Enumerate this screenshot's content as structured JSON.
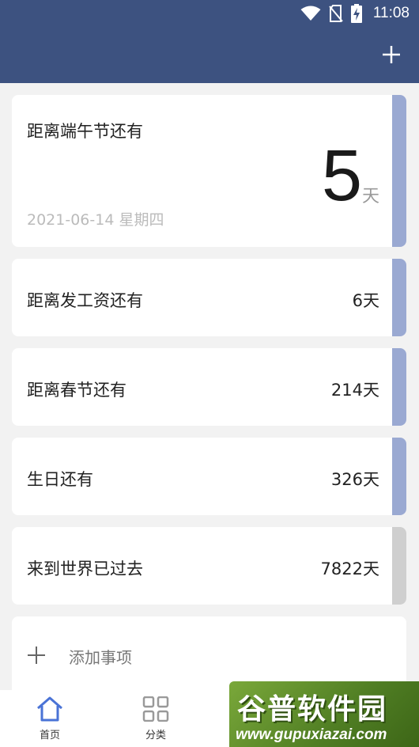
{
  "status_bar": {
    "time": "11:08"
  },
  "header": {
    "add_icon": "plus-icon"
  },
  "featured": {
    "title": "距离端午节还有",
    "days": "5",
    "unit": "天",
    "date": "2021-06-14 星期四",
    "stripe_color": "#9aa9d2"
  },
  "events": [
    {
      "title": "距离发工资还有",
      "days": "6天",
      "stripe_color": "#9aa9d2"
    },
    {
      "title": "距离春节还有",
      "days": "214天",
      "stripe_color": "#9aa9d2"
    },
    {
      "title": "生日还有",
      "days": "326天",
      "stripe_color": "#9aa9d2"
    },
    {
      "title": "来到世界已过去",
      "days": "7822天",
      "stripe_color": "#cfcfcf"
    }
  ],
  "add_item": {
    "label": "添加事项"
  },
  "bottom_nav": [
    {
      "label": "首页",
      "icon": "home-icon",
      "active": true
    },
    {
      "label": "分类",
      "icon": "grid-icon",
      "active": false
    }
  ],
  "watermark": {
    "title": "谷普软件园",
    "url": "www.gupuxiazai.com"
  },
  "colors": {
    "header": "#3d5280",
    "accent": "#4a73d6"
  }
}
